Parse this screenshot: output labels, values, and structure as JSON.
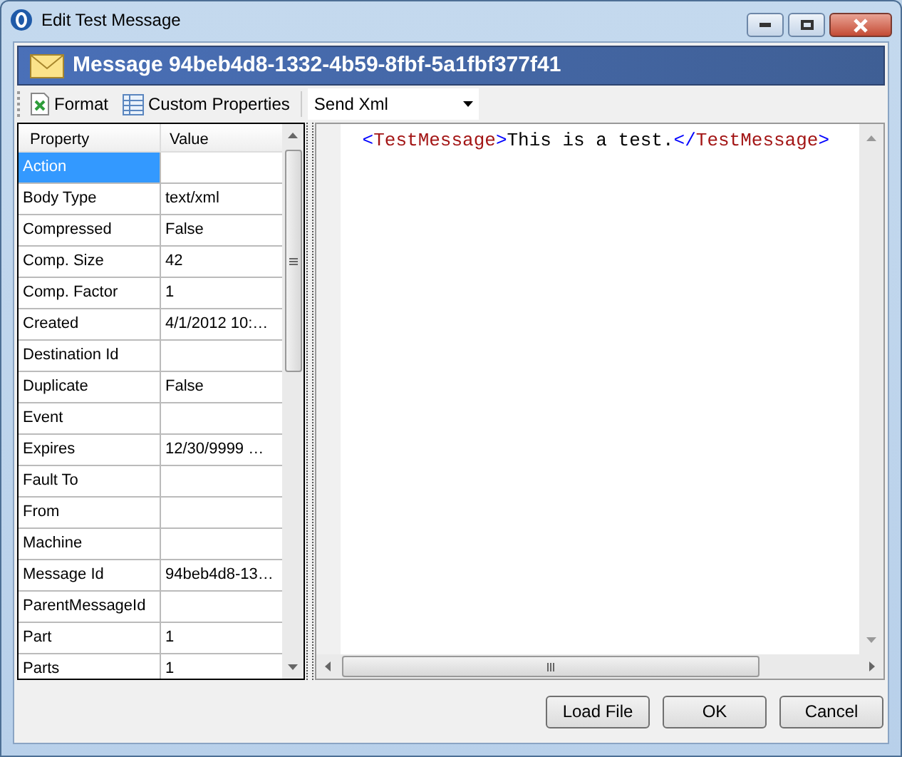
{
  "window": {
    "title": "Edit Test Message"
  },
  "header": {
    "title": "Message 94beb4d8-1332-4b59-8fbf-5a1fbf377f41"
  },
  "toolbar": {
    "buttons": [
      {
        "kind": "format",
        "label": "Format"
      },
      {
        "kind": "properties",
        "label": "Custom Properties"
      }
    ],
    "dropdown": {
      "value": "Send Xml"
    }
  },
  "property_grid": {
    "columns": [
      "Property",
      "Value"
    ],
    "rows": [
      {
        "name": "Action",
        "selected": true
      },
      {
        "name": "Body Type",
        "value": "text/xml",
        "selected": false
      },
      {
        "name": "Compressed",
        "value": "False",
        "selected": false
      },
      {
        "name": "Comp. Size",
        "value": "42",
        "selected": false
      },
      {
        "name": "Comp. Factor",
        "value": "1",
        "selected": false
      },
      {
        "name": "Created",
        "value": "4/1/2012 10:…",
        "selected": false
      },
      {
        "name": "Destination Id",
        "selected": false
      },
      {
        "name": "Duplicate",
        "value": "False",
        "selected": false
      },
      {
        "name": "Event",
        "selected": false
      },
      {
        "name": "Expires",
        "value": "12/30/9999 …",
        "selected": false
      },
      {
        "name": "Fault To",
        "selected": false
      },
      {
        "name": "From",
        "selected": false
      },
      {
        "name": "Machine",
        "selected": false
      },
      {
        "name": "Message Id",
        "value": "94beb4d8-13…",
        "selected": false
      },
      {
        "name": "ParentMessageId",
        "selected": false
      },
      {
        "name": "Part",
        "value": "1",
        "selected": false
      },
      {
        "name": "Parts",
        "value": "1",
        "selected": false
      }
    ]
  },
  "editor": {
    "lines": [
      [
        {
          "kind": "bracket",
          "text": "<"
        },
        {
          "kind": "tag",
          "text": "TestMessage"
        },
        {
          "kind": "bracket",
          "text": ">"
        },
        {
          "kind": "text",
          "text": "This is a test."
        },
        {
          "kind": "bracket",
          "text": "</"
        },
        {
          "kind": "tag",
          "text": "TestMessage"
        },
        {
          "kind": "bracket",
          "text": ">"
        }
      ]
    ]
  },
  "buttons": [
    "Load File",
    "OK",
    "Cancel"
  ]
}
